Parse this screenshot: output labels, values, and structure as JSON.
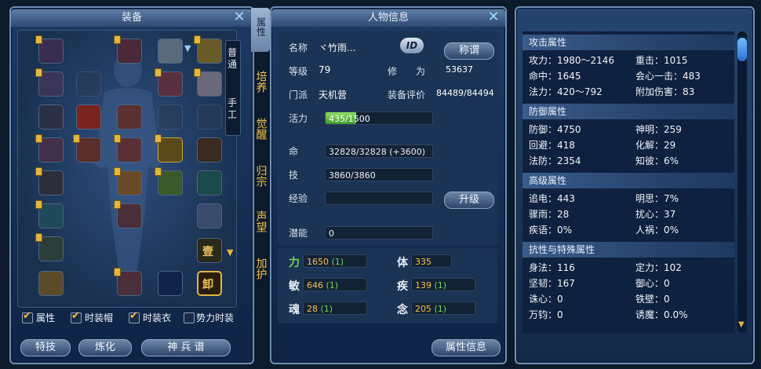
{
  "equipment": {
    "title": "装备",
    "side_tabs": [
      "属性",
      "培养",
      "觉醒",
      "归宗",
      "声望",
      "加护"
    ],
    "craft_tabs": [
      "普通",
      "手工"
    ],
    "unequip_label": "卸",
    "gem_label": "壹",
    "checkboxes": [
      {
        "label": "属性",
        "checked": true
      },
      {
        "label": "时装帽",
        "checked": true
      },
      {
        "label": "时装衣",
        "checked": true
      },
      {
        "label": "势力时装",
        "checked": false
      }
    ],
    "buttons": [
      "特技",
      "炼化",
      "神 兵 谱"
    ]
  },
  "character": {
    "title": "人物信息",
    "name_label": "名称",
    "name_value": "ヾ竹雨...",
    "id_badge": "ID",
    "title_button": "称谓",
    "level_label": "等级",
    "level_value": "79",
    "cultivation_label": "修　　为",
    "cultivation_value": "53637",
    "sect_label": "门派",
    "sect_value": "天机营",
    "rating_label": "装备评价",
    "rating_value": "84489/84494",
    "vitality_label": "活力",
    "vitality_value": "435/1500",
    "vitality_fraction": 0.29,
    "hp_label": "命",
    "hp_value": "32828/32828 (+3600)",
    "skill_label": "技",
    "skill_value": "3860/3860",
    "exp_label": "经验",
    "exp_value": "",
    "levelup_button": "升级",
    "potential_label": "潜能",
    "potential_value": "0",
    "stats": [
      {
        "label": "力",
        "value": "1650",
        "bonus": "(1)"
      },
      {
        "label": "体",
        "value": "335",
        "bonus": ""
      },
      {
        "label": "敏",
        "value": "646",
        "bonus": "(1)"
      },
      {
        "label": "疾",
        "value": "139",
        "bonus": "(1)"
      },
      {
        "label": "魂",
        "value": "28",
        "bonus": "(1)"
      },
      {
        "label": "念",
        "value": "205",
        "bonus": "(1)"
      }
    ],
    "attr_info_button": "属性信息"
  },
  "attributes": {
    "sections": [
      {
        "title": "攻击属性",
        "rows": [
          [
            "攻力：1980～2146",
            "重击：1015"
          ],
          [
            "命中：1645",
            "会心一击：483"
          ],
          [
            "法力：420～792",
            "附加伤害：83"
          ]
        ]
      },
      {
        "title": "防御属性",
        "rows": [
          [
            "防御：4750",
            "神明：259"
          ],
          [
            "回避：418",
            "化解：29"
          ],
          [
            "法防：2354",
            "知彼：6%"
          ]
        ]
      },
      {
        "title": "高级属性",
        "rows": [
          [
            "追电：443",
            "明思：7%"
          ],
          [
            "骤雨：28",
            "扰心：37"
          ],
          [
            "疾语：0%",
            "人祸：0%"
          ]
        ]
      },
      {
        "title": "抗性与特殊属性",
        "rows": [
          [
            "身法：116",
            "定力：102"
          ],
          [
            "坚韧：167",
            "御心：0"
          ],
          [
            "诛心：0",
            "铁壁：0"
          ],
          [
            "万钧：0",
            "诱魔：0.0%"
          ]
        ]
      }
    ]
  }
}
